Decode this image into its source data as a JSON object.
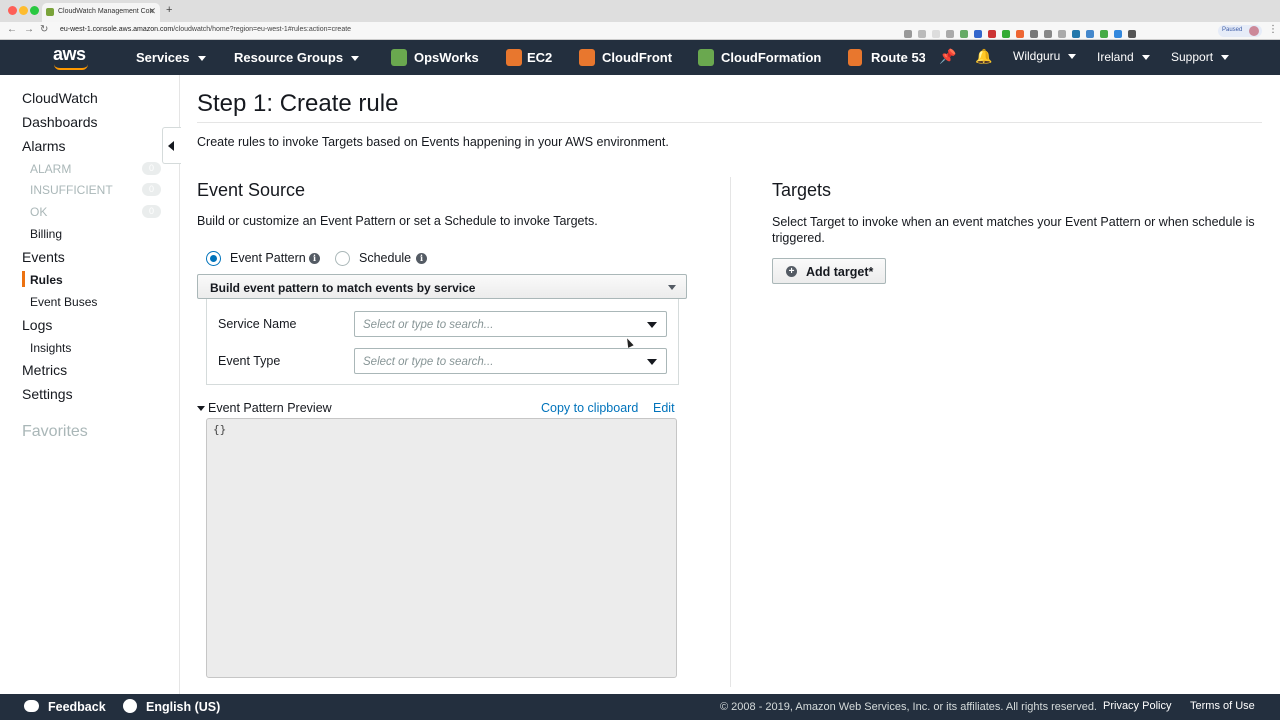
{
  "browser": {
    "tab_title": "CloudWatch Management Con",
    "url_host": "eu-west-1.console.aws.amazon.com",
    "url_path": "/cloudwatch/home?region=eu-west-1#rules:action=create",
    "paused_label": "Paused"
  },
  "header": {
    "logo": "aws",
    "nav": [
      {
        "label": "Services"
      },
      {
        "label": "Resource Groups"
      },
      {
        "label": "OpsWorks"
      },
      {
        "label": "EC2"
      },
      {
        "label": "CloudFront"
      },
      {
        "label": "CloudFormation"
      },
      {
        "label": "Route 53"
      }
    ],
    "account": "Wildguru",
    "region": "Ireland",
    "support": "Support"
  },
  "sidebar": {
    "cloudwatch": "CloudWatch",
    "dashboards": "Dashboards",
    "alarms": "Alarms",
    "alarm": {
      "label": "ALARM",
      "count": "0"
    },
    "insufficient": {
      "label": "INSUFFICIENT",
      "count": "0"
    },
    "ok": {
      "label": "OK",
      "count": "0"
    },
    "billing": "Billing",
    "events": "Events",
    "rules": "Rules",
    "event_buses": "Event Buses",
    "logs": "Logs",
    "insights": "Insights",
    "metrics": "Metrics",
    "settings": "Settings",
    "favorites": "Favorites"
  },
  "main": {
    "title": "Step 1: Create rule",
    "description": "Create rules to invoke Targets based on Events happening in your AWS environment.",
    "event_source": {
      "title": "Event Source",
      "description": "Build or customize an Event Pattern or set a Schedule to invoke Targets.",
      "radio_event_pattern": "Event Pattern",
      "radio_schedule": "Schedule",
      "builder_select": "Build event pattern to match events by service",
      "service_name_label": "Service Name",
      "service_name_placeholder": "Select or type to search...",
      "event_type_label": "Event Type",
      "event_type_placeholder": "Select or type to search...",
      "preview_label": "Event Pattern Preview",
      "copy_link": "Copy to clipboard",
      "edit_link": "Edit",
      "preview_code": "{}"
    },
    "targets": {
      "title": "Targets",
      "description": "Select Target to invoke when an event matches your Event Pattern or when schedule is triggered.",
      "add_button": "Add target*"
    }
  },
  "footer": {
    "feedback": "Feedback",
    "language": "English (US)",
    "copyright": "© 2008 - 2019, Amazon Web Services, Inc. or its affiliates. All rights reserved.",
    "privacy": "Privacy Policy",
    "terms": "Terms of Use"
  },
  "colors": {
    "header_bg": "#232f3e",
    "accent_orange": "#ec7211",
    "link_blue": "#0073bb"
  }
}
